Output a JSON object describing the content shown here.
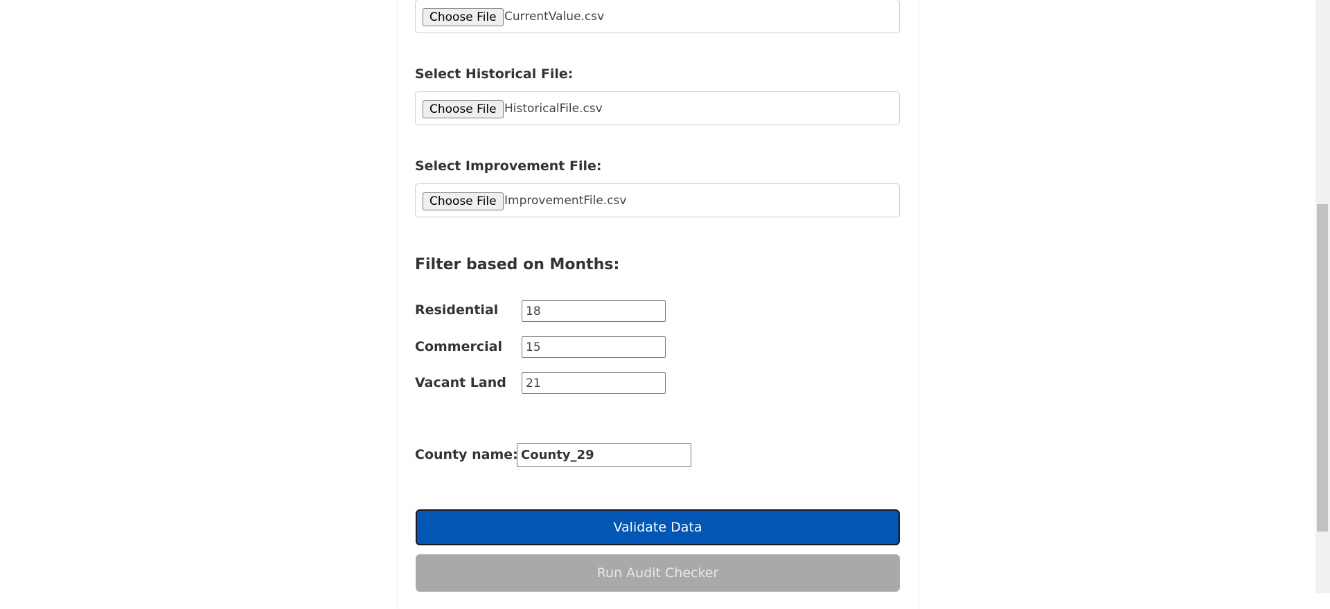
{
  "files": [
    {
      "label": "",
      "button_label": "Choose File",
      "file_name": "CurrentValue.csv"
    },
    {
      "label": "Select Historical File:",
      "button_label": "Choose File",
      "file_name": "HistoricalFile.csv"
    },
    {
      "label": "Select Improvement File:",
      "button_label": "Choose File",
      "file_name": "ImprovementFile.csv"
    }
  ],
  "filter": {
    "heading": "Filter based on Months:",
    "residential": {
      "label": "Residential",
      "value": "18"
    },
    "commercial": {
      "label": "Commercial",
      "value": "15"
    },
    "vacant_land": {
      "label": "Vacant Land",
      "value": "21"
    }
  },
  "county": {
    "label": "County name:",
    "value": "County_29"
  },
  "actions": {
    "validate_label": "Validate Data",
    "audit_label": "Run Audit Checker"
  },
  "colors": {
    "validate_bg": "#0256b4",
    "audit_bg": "#a9a9a9"
  }
}
